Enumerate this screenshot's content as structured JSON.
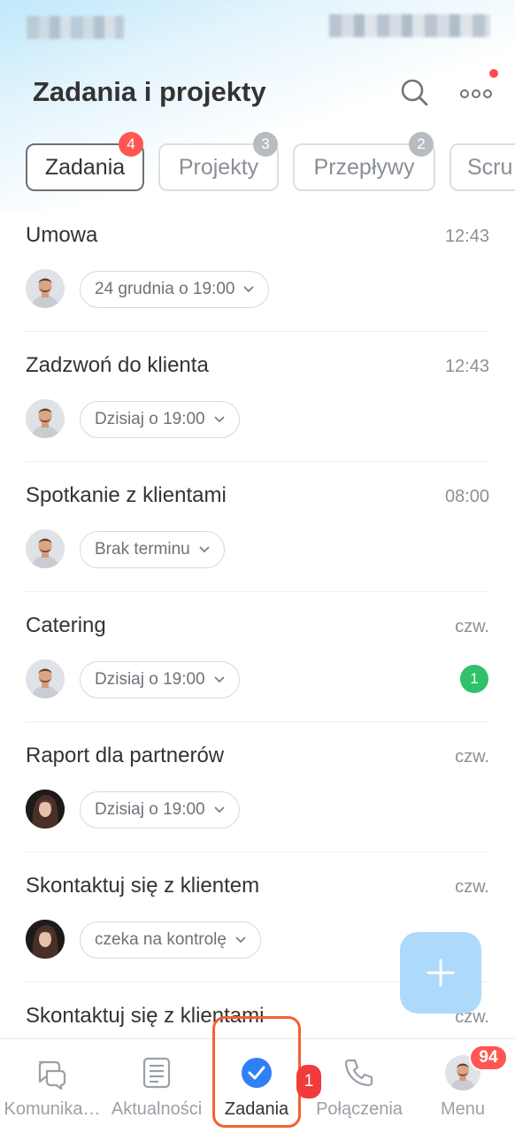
{
  "header": {
    "title": "Zadania i projekty",
    "search_icon": "search-icon",
    "more_icon": "more-icon"
  },
  "tabs": [
    {
      "label": "Zadania",
      "badge": "4",
      "active": true
    },
    {
      "label": "Projekty",
      "badge": "3",
      "active": false
    },
    {
      "label": "Przepływy",
      "badge": "2",
      "active": false
    },
    {
      "label": "Scru",
      "badge": "",
      "active": false
    }
  ],
  "tasks": [
    {
      "title": "Umowa",
      "time": "12:43",
      "deadline": "24 grudnia o 19:00"
    },
    {
      "title": "Zadzwoń do klienta",
      "time": "12:43",
      "deadline": "Dzisiaj o 19:00"
    },
    {
      "title": "Spotkanie z klientami",
      "time": "08:00",
      "deadline": "Brak terminu"
    },
    {
      "title": "Catering",
      "time": "czw.",
      "deadline": "Dzisiaj o 19:00",
      "counter": "1"
    },
    {
      "title": "Raport dla partnerów",
      "time": "czw.",
      "deadline": "Dzisiaj o 19:00"
    },
    {
      "title": "Skontaktuj się z klientem",
      "time": "czw.",
      "deadline": "czeka na kontrolę"
    },
    {
      "title": "Skontaktuj się z klientami",
      "time": "czw."
    }
  ],
  "bottom_nav": {
    "items": [
      {
        "label": "Komunika…",
        "icon": "chat-icon"
      },
      {
        "label": "Aktualności",
        "icon": "news-icon"
      },
      {
        "label": "Zadania",
        "icon": "check-circle-icon",
        "active": true
      },
      {
        "label": "Połączenia",
        "icon": "phone-icon"
      },
      {
        "label": "Menu",
        "icon": "avatar"
      }
    ],
    "tasks_badge": "1",
    "menu_badge": "94"
  },
  "colors": {
    "accent": "#2f7ff5",
    "badge_red": "#ff5752",
    "counter_green": "#2fc26b",
    "highlight": "#f06234",
    "fab": "#a9d8fb"
  }
}
